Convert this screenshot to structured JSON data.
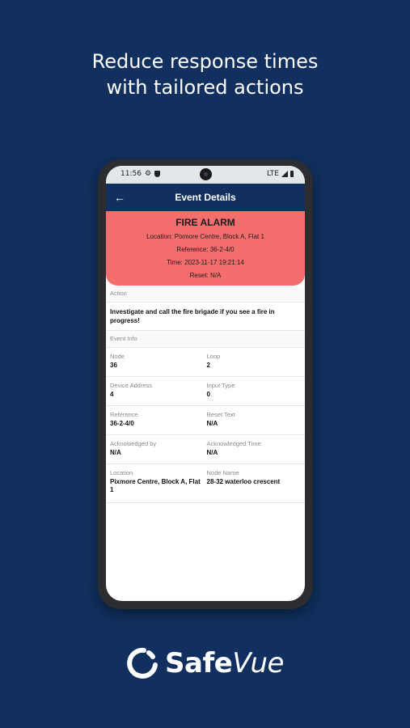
{
  "headline": {
    "line1": "Reduce response times",
    "line2": "with tailored actions"
  },
  "status_bar": {
    "time": "11:56",
    "network": "LTE"
  },
  "app_bar": {
    "title": "Event Details"
  },
  "alarm": {
    "title": "FIRE ALARM",
    "location": "Location: Pixmore Centre, Block A, Flat 1",
    "reference": "Reference: 36-2-4/0",
    "time": "Time: 2023-11-17 19:21:14",
    "reset": "Reset: N/A",
    "color": "#f46e6e"
  },
  "action_section": {
    "header": "Action",
    "text": "Investigate and call the fire brigade if you see a fire in progress!"
  },
  "event_info": {
    "header": "Event Info",
    "rows": [
      [
        {
          "label": "Node",
          "value": "36"
        },
        {
          "label": "Loop",
          "value": "2"
        }
      ],
      [
        {
          "label": "Device Address",
          "value": "4"
        },
        {
          "label": "Input Type",
          "value": "0"
        }
      ],
      [
        {
          "label": "Reference",
          "value": "36-2-4/0"
        },
        {
          "label": "Reset Text",
          "value": "N/A"
        }
      ],
      [
        {
          "label": "Acknowedged by",
          "value": "N/A"
        },
        {
          "label": "Acknowledged Time",
          "value": "N/A"
        }
      ],
      [
        {
          "label": "Location",
          "value": "Pixmore Centre, Block A, Flat 1"
        },
        {
          "label": "Node Name",
          "value": "28-32 waterloo crescent"
        }
      ]
    ]
  },
  "brand": {
    "name_bold": "Safe",
    "name_italic": "Vue",
    "background": "#11305f"
  }
}
